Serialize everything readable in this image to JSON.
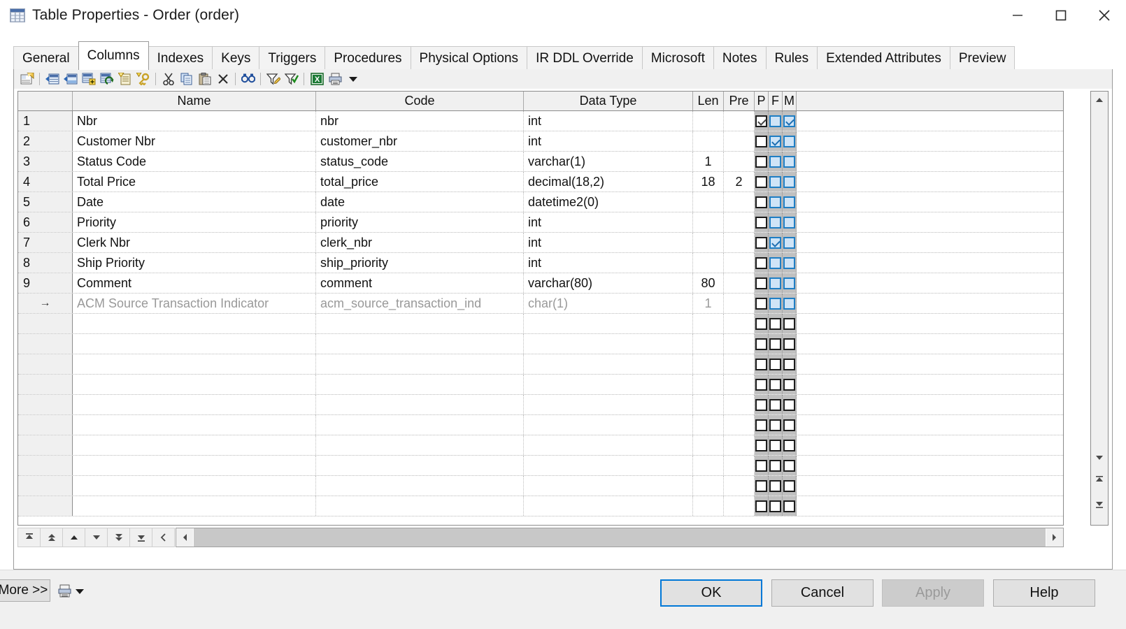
{
  "window": {
    "title": "Table Properties - Order (order)",
    "icon": "table-icon",
    "controls": {
      "minimize": "minimize-icon",
      "maximize": "maximize-icon",
      "close": "close-icon"
    }
  },
  "tabs": [
    {
      "label": "General",
      "active": false
    },
    {
      "label": "Columns",
      "active": true
    },
    {
      "label": "Indexes",
      "active": false
    },
    {
      "label": "Keys",
      "active": false
    },
    {
      "label": "Triggers",
      "active": false
    },
    {
      "label": "Procedures",
      "active": false
    },
    {
      "label": "Physical Options",
      "active": false
    },
    {
      "label": "IR DDL Override",
      "active": false
    },
    {
      "label": "Microsoft",
      "active": false
    },
    {
      "label": "Notes",
      "active": false
    },
    {
      "label": "Rules",
      "active": false
    },
    {
      "label": "Extended Attributes",
      "active": false
    },
    {
      "label": "Preview",
      "active": false
    }
  ],
  "toolbar": {
    "items": [
      {
        "icon": "properties-icon",
        "sep_after": true
      },
      {
        "icon": "insert-row-icon",
        "sep_after": false
      },
      {
        "icon": "append-row-icon",
        "sep_after": false
      },
      {
        "icon": "add-object-icon",
        "sep_after": false
      },
      {
        "icon": "replace-object-icon",
        "sep_after": false
      },
      {
        "icon": "new-note-icon",
        "sep_after": false
      },
      {
        "icon": "new-key-icon",
        "sep_after": true
      },
      {
        "icon": "cut-icon",
        "sep_after": false
      },
      {
        "icon": "copy-icon",
        "sep_after": false
      },
      {
        "icon": "paste-icon",
        "sep_after": false
      },
      {
        "icon": "delete-icon",
        "sep_after": true
      },
      {
        "icon": "find-icon",
        "sep_after": true
      },
      {
        "icon": "filter-icon",
        "sep_after": false
      },
      {
        "icon": "apply-filter-icon",
        "sep_after": true
      },
      {
        "icon": "export-excel-icon",
        "sep_after": false
      },
      {
        "icon": "print-icon",
        "sep_after": false
      },
      {
        "icon": "dropdown-caret-icon",
        "sep_after": false
      }
    ]
  },
  "grid": {
    "headers": [
      {
        "key": "rownum",
        "label": ""
      },
      {
        "key": "name",
        "label": "Name"
      },
      {
        "key": "code",
        "label": "Code"
      },
      {
        "key": "datatype",
        "label": "Data Type"
      },
      {
        "key": "len",
        "label": "Len"
      },
      {
        "key": "pre",
        "label": "Pre"
      },
      {
        "key": "p",
        "label": "P"
      },
      {
        "key": "f",
        "label": "F"
      },
      {
        "key": "m",
        "label": "M"
      },
      {
        "key": "fill",
        "label": ""
      }
    ],
    "rows": [
      {
        "num": "1",
        "name": "Nbr",
        "code": "nbr",
        "datatype": "int",
        "len": "",
        "pre": "",
        "p": "checked-disabled",
        "f": "unchecked",
        "m": "checked",
        "new": false
      },
      {
        "num": "2",
        "name": "Customer Nbr",
        "code": "customer_nbr",
        "datatype": "int",
        "len": "",
        "pre": "",
        "p": "unchecked",
        "f": "checked",
        "m": "unchecked",
        "new": false
      },
      {
        "num": "3",
        "name": "Status Code",
        "code": "status_code",
        "datatype": "varchar(1)",
        "len": "1",
        "pre": "",
        "p": "unchecked",
        "f": "unchecked",
        "m": "unchecked",
        "new": false
      },
      {
        "num": "4",
        "name": "Total Price",
        "code": "total_price",
        "datatype": "decimal(18,2)",
        "len": "18",
        "pre": "2",
        "p": "unchecked",
        "f": "unchecked",
        "m": "unchecked",
        "new": false
      },
      {
        "num": "5",
        "name": "Date",
        "code": "date",
        "datatype": "datetime2(0)",
        "len": "",
        "pre": "",
        "p": "unchecked",
        "f": "unchecked",
        "m": "unchecked",
        "new": false
      },
      {
        "num": "6",
        "name": "Priority",
        "code": "priority",
        "datatype": "int",
        "len": "",
        "pre": "",
        "p": "unchecked",
        "f": "unchecked",
        "m": "unchecked",
        "new": false
      },
      {
        "num": "7",
        "name": "Clerk Nbr",
        "code": "clerk_nbr",
        "datatype": "int",
        "len": "",
        "pre": "",
        "p": "unchecked",
        "f": "checked",
        "m": "unchecked",
        "new": false
      },
      {
        "num": "8",
        "name": "Ship Priority",
        "code": "ship_priority",
        "datatype": "int",
        "len": "",
        "pre": "",
        "p": "unchecked",
        "f": "unchecked",
        "m": "unchecked",
        "new": false
      },
      {
        "num": "9",
        "name": "Comment",
        "code": "comment",
        "datatype": "varchar(80)",
        "len": "80",
        "pre": "",
        "p": "unchecked",
        "f": "unchecked",
        "m": "unchecked",
        "new": false
      },
      {
        "num": "→",
        "name": "ACM Source Transaction Indicator",
        "code": "acm_source_transaction_ind",
        "datatype": "char(1)",
        "len": "1",
        "pre": "",
        "p": "unchecked",
        "f": "unchecked",
        "m": "unchecked",
        "new": true
      }
    ],
    "empty_rows": 10
  },
  "navbar": {
    "buttons": [
      {
        "icon": "first-row-icon"
      },
      {
        "icon": "prev-page-icon"
      },
      {
        "icon": "prev-row-icon"
      },
      {
        "icon": "next-row-icon"
      },
      {
        "icon": "next-page-icon"
      },
      {
        "icon": "last-row-icon"
      },
      {
        "icon": "scroll-left-icon"
      }
    ]
  },
  "scrollbar": {
    "up": "scroll-up-icon",
    "down": "scroll-down-icon",
    "top": "scroll-to-top-icon",
    "bottom": "scroll-to-bottom-icon",
    "left": "scroll-left-icon",
    "right": "scroll-right-icon"
  },
  "footer": {
    "more_label": "More >>",
    "report_icon": "report-icon",
    "buttons": [
      {
        "id": "ok",
        "label": "OK",
        "state": "default-focused"
      },
      {
        "id": "cancel",
        "label": "Cancel",
        "state": "normal"
      },
      {
        "id": "apply",
        "label": "Apply",
        "state": "disabled"
      },
      {
        "id": "help",
        "label": "Help",
        "state": "normal"
      }
    ]
  },
  "colors": {
    "accent": "#0078d7",
    "checkbox_blue": "#1f7ec4",
    "checkbox_blue_fill": "#cfe4f7",
    "checkbox_column_bg": "#c0c0c0",
    "panel_bg": "#f0f0f0",
    "new_row_text": "#999999"
  }
}
